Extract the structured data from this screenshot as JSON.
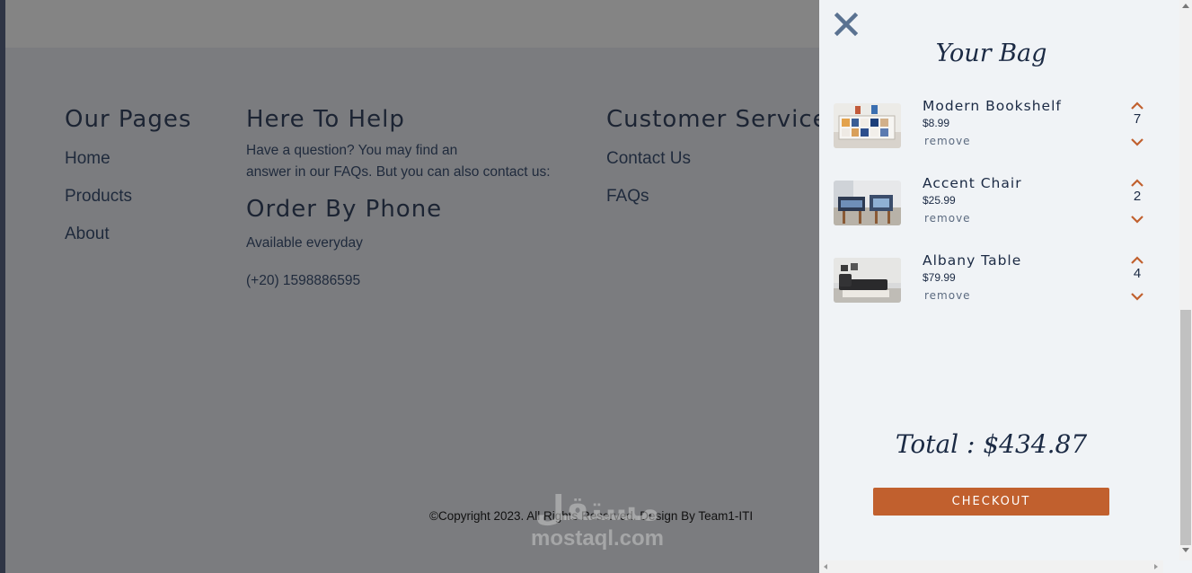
{
  "footer": {
    "pages": {
      "title": "Our Pages",
      "links": [
        "Home",
        "Products",
        "About"
      ]
    },
    "help": {
      "title": "Here To Help",
      "text_line1": "Have a question? You may find an",
      "text_line2": "answer in our FAQs. But you can also contact us:",
      "phone_title": "Order By Phone",
      "availability": "Available everyday",
      "phone": "(+20) 1598886595"
    },
    "service": {
      "title": "Customer Service",
      "links": [
        "Contact Us",
        "FAQs"
      ]
    },
    "copyright": "©Copyright 2023. All Rights Reserved. Design By Team1-ITI"
  },
  "watermark": {
    "arabic": "مستقل",
    "latin": "mostaql.com"
  },
  "cart": {
    "title": "Your Bag",
    "remove_label": "remove",
    "items": [
      {
        "name": "Modern Bookshelf",
        "price": "$8.99",
        "qty": "7"
      },
      {
        "name": "Accent Chair",
        "price": "$25.99",
        "qty": "2"
      },
      {
        "name": "Albany Table",
        "price": "$79.99",
        "qty": "4"
      }
    ],
    "total": "Total : $434.87",
    "checkout_label": "CHECKOUT"
  },
  "colors": {
    "accent": "#c1602e",
    "navy": "#1b2a44",
    "close_icon": "#5a7291",
    "overlay_bg": "#7b7c7f"
  },
  "icons": {
    "close": "close-icon",
    "up": "chevron-up-icon",
    "down": "chevron-down-icon"
  }
}
